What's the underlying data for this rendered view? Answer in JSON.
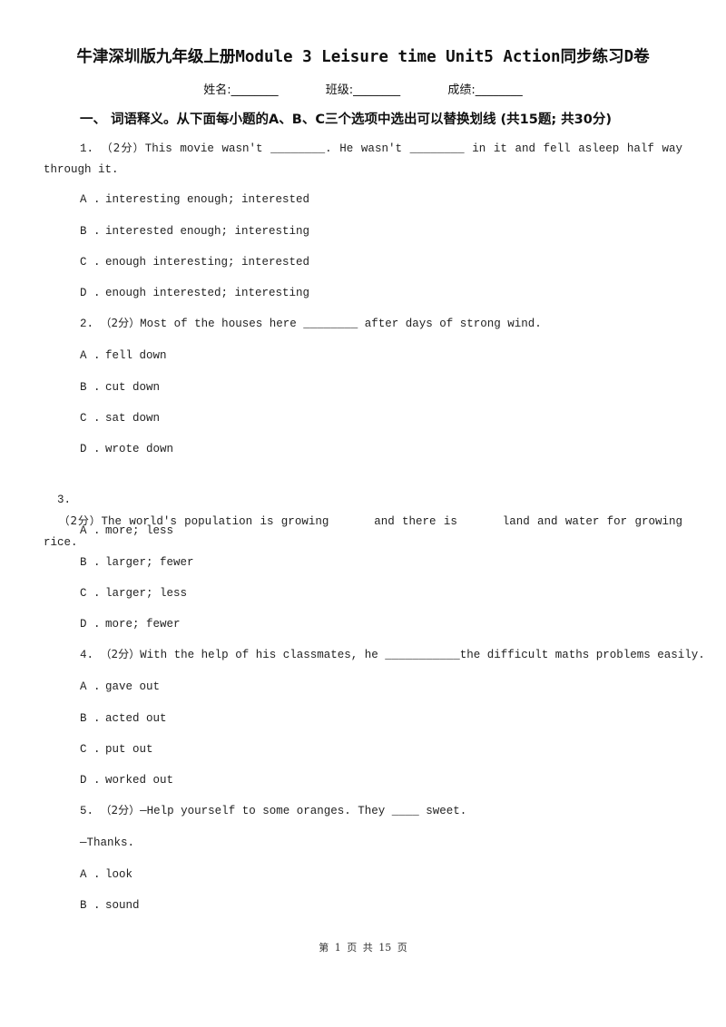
{
  "document": {
    "title": "牛津深圳版九年级上册Module 3 Leisure time Unit5 Action同步练习D卷",
    "info_fields": [
      {
        "label": "姓名:________"
      },
      {
        "label": "班级:________"
      },
      {
        "label": "成绩:________"
      }
    ],
    "section": {
      "header": "一、 词语释义。从下面每小题的A、B、C三个选项中选出可以替换划线 (共15题; 共30分)"
    },
    "questions": [
      {
        "number": "1.",
        "score": "（2分）",
        "text": "This movie wasn't ________. He wasn't ________ in it and fell asleep half way through it.",
        "options": [
          {
            "letter": "A .",
            "text": "interesting enough; interested"
          },
          {
            "letter": "B .",
            "text": "interested enough; interesting"
          },
          {
            "letter": "C .",
            "text": "enough interesting; interested"
          },
          {
            "letter": "D .",
            "text": "enough interested; interesting"
          }
        ]
      },
      {
        "number": "2.",
        "score": "（2分）",
        "text": "Most of the houses here ________ after days of strong wind.",
        "options": [
          {
            "letter": "A .",
            "text": "fell down"
          },
          {
            "letter": "B .",
            "text": "cut down"
          },
          {
            "letter": "C .",
            "text": "sat down"
          },
          {
            "letter": "D .",
            "text": "wrote down"
          }
        ]
      },
      {
        "number": "3.",
        "score": "（2分）",
        "text": "The world's population is growing      and there is      land and water for growing rice.",
        "options": [
          {
            "letter": "A .",
            "text": "more; less"
          },
          {
            "letter": "B .",
            "text": "larger; fewer"
          },
          {
            "letter": "C .",
            "text": "larger; less"
          },
          {
            "letter": "D .",
            "text": "more; fewer"
          }
        ]
      },
      {
        "number": "4.",
        "score": "（2分）",
        "text": "With the help of his classmates, he ___________the difficult maths problems easily.",
        "options": [
          {
            "letter": "A .",
            "text": "gave out"
          },
          {
            "letter": "B .",
            "text": "acted out"
          },
          {
            "letter": "C .",
            "text": "put out"
          },
          {
            "letter": "D .",
            "text": "worked out"
          }
        ]
      },
      {
        "number": "5.",
        "score": "（2分）",
        "text": "—Help yourself to some oranges. They ____ sweet.",
        "reply": "—Thanks.",
        "options": [
          {
            "letter": "A .",
            "text": "look"
          },
          {
            "letter": "B .",
            "text": "sound"
          }
        ]
      }
    ],
    "footer": {
      "page_label": "第 1 页 共 15 页"
    }
  }
}
